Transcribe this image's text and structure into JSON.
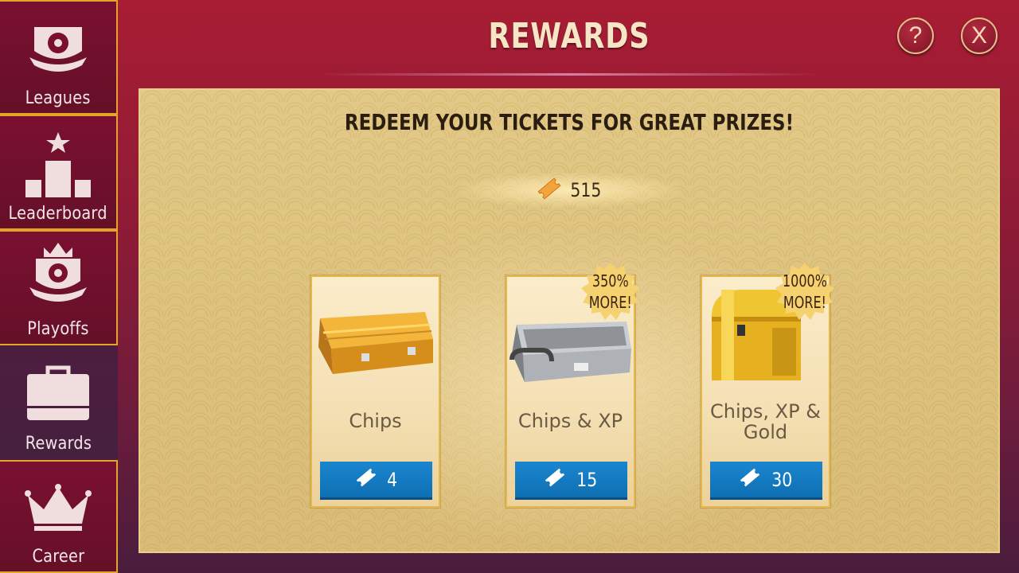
{
  "sidebar": {
    "items": [
      {
        "label": "Leagues",
        "icon": "league-shield-icon"
      },
      {
        "label": "Leaderboard",
        "icon": "podium-icon"
      },
      {
        "label": "Playoffs",
        "icon": "playoffs-crown-shield-icon"
      },
      {
        "label": "Rewards",
        "icon": "briefcase-icon",
        "active": true
      },
      {
        "label": "Career",
        "icon": "crown-icon"
      }
    ]
  },
  "header": {
    "title": "REWARDS",
    "help_label": "?",
    "close_label": "X"
  },
  "panel": {
    "headline": "REDEEM YOUR TICKETS FOR GREAT PRIZES!",
    "ticket_balance": "515"
  },
  "rewards": [
    {
      "name": "Chips",
      "price": "4",
      "badge": null,
      "image": "gold-briefcase"
    },
    {
      "name": "Chips & XP",
      "price": "15",
      "badge": [
        "350%",
        "MORE!"
      ],
      "image": "silver-briefcase"
    },
    {
      "name": "Chips, XP & Gold",
      "name_lines": [
        "Chips, XP &",
        "Gold"
      ],
      "price": "30",
      "badge": [
        "1000%",
        "MORE!"
      ],
      "image": "gold-chest"
    }
  ],
  "colors": {
    "background": "#9a1c34",
    "sidebar": "#6e1030",
    "sidebar_border": "#e5a32a",
    "panel": "#dcc07e",
    "button": "#1580c8",
    "title_text": "#f7e6c6"
  }
}
